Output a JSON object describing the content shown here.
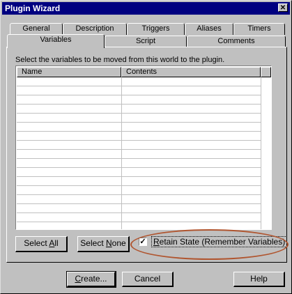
{
  "window": {
    "title": "Plugin Wizard",
    "close_glyph": "✕"
  },
  "tabs_back": [
    "General",
    "Description",
    "Triggers",
    "Aliases",
    "Timers"
  ],
  "tabs_front": [
    "Variables",
    "Script",
    "Comments"
  ],
  "active_tab": "Variables",
  "instructions": "Select the variables to be moved from this world to the plugin.",
  "list": {
    "columns": [
      "Name",
      "Contents"
    ],
    "rows": []
  },
  "buttons": {
    "select_all": {
      "pre": "Select ",
      "key": "A",
      "post": "ll"
    },
    "select_none": {
      "pre": "Select ",
      "key": "N",
      "post": "one"
    },
    "create": {
      "pre": "",
      "key": "C",
      "post": "reate..."
    },
    "cancel": "Cancel",
    "help": "Help"
  },
  "retain_state": {
    "checked": true,
    "check_glyph": "✓",
    "pre": "",
    "key": "R",
    "post": "etain State (Remember Variables)"
  },
  "colors": {
    "titlebar": "#000080",
    "face": "#c0c0c0",
    "highlight_ellipse": "#b0552f"
  }
}
